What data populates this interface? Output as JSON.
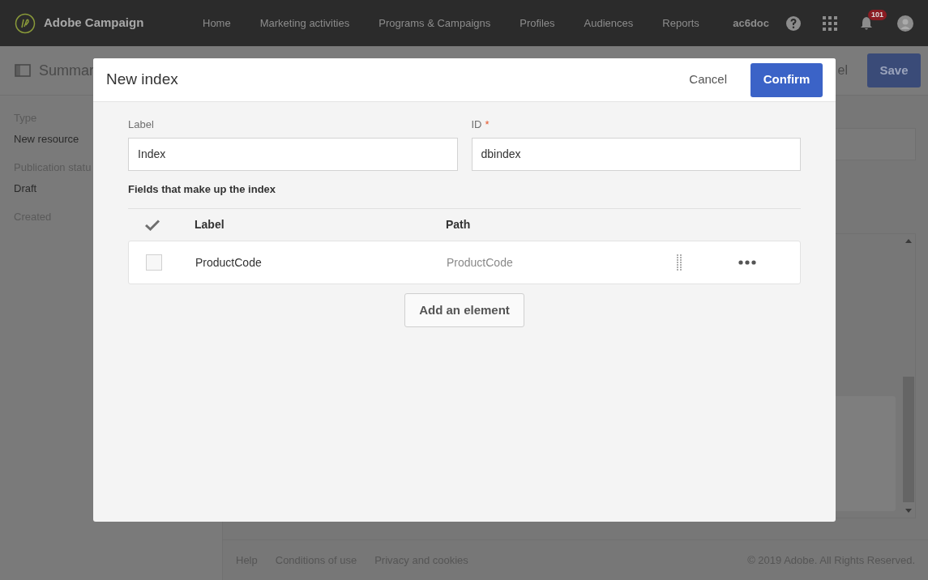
{
  "navbar": {
    "brand": "Adobe Campaign",
    "items": [
      {
        "label": "Home",
        "selected": false
      },
      {
        "label": "Marketing activities",
        "selected": false
      },
      {
        "label": "Programs & Campaigns",
        "selected": false
      },
      {
        "label": "Profiles",
        "selected": false
      },
      {
        "label": "Audiences",
        "selected": false
      },
      {
        "label": "Reports",
        "selected": false
      }
    ],
    "user": "ac6doc",
    "notification_count": "101"
  },
  "page_header": {
    "title": "Summar",
    "cancel": "el",
    "save": "Save"
  },
  "sidebar": {
    "fields": [
      {
        "label": "Type",
        "value": "New resource"
      },
      {
        "label": "Publication statu",
        "value": "Draft"
      },
      {
        "label": "Created"
      }
    ]
  },
  "footer": {
    "links": [
      "Help",
      "Conditions of use",
      "Privacy and cookies"
    ],
    "copyright": "© 2019 Adobe. All Rights Reserved."
  },
  "dialog": {
    "title": "New index",
    "cancel": "Cancel",
    "confirm": "Confirm",
    "label_field": {
      "label": "Label",
      "value": "Index"
    },
    "id_field": {
      "label": "ID",
      "required_mark": "*",
      "value": "dbindex"
    },
    "section_title": "Fields that make up the index",
    "table": {
      "columns": [
        "Label",
        "Path"
      ],
      "rows": [
        {
          "label": "ProductCode",
          "path": "ProductCode",
          "checked": false
        }
      ]
    },
    "add_button": "Add an element"
  }
}
